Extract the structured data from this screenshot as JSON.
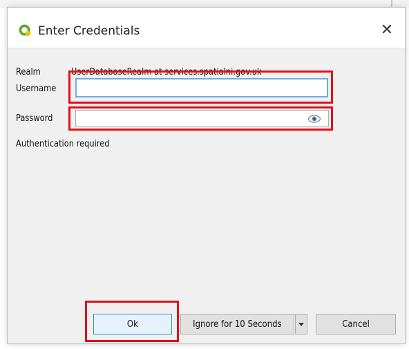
{
  "window": {
    "title": "Enter Credentials",
    "close_symbol": "✕",
    "icon": "qgis-icon"
  },
  "form": {
    "realm_label": "Realm",
    "realm_value": "UserDatabaseRealm at services.spatialni.gov.uk",
    "username_label": "Username",
    "username_value": "",
    "password_label": "Password",
    "password_value": "",
    "status_text": "Authentication required"
  },
  "buttons": {
    "ok_label": "Ok",
    "ignore_label": "Ignore for 10 Seconds",
    "cancel_label": "Cancel"
  },
  "colors": {
    "highlight": "#e0101a",
    "focus": "#65aee9",
    "qgis_green": "#5aa839"
  }
}
